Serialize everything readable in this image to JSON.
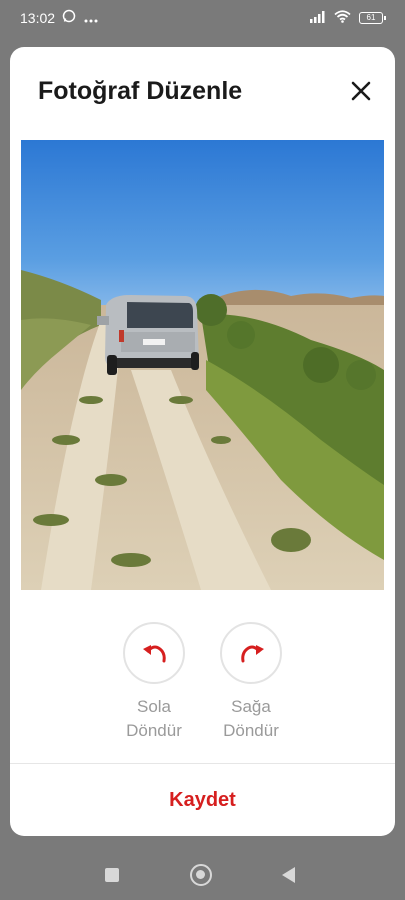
{
  "status_bar": {
    "time": "13:02",
    "battery": "61",
    "icons": [
      "whatsapp-icon",
      "more-dots-icon",
      "signal-icon",
      "wifi-icon",
      "battery-icon"
    ]
  },
  "modal": {
    "title": "Fotoğraf Düzenle",
    "close_icon": "close-icon",
    "photo_subject": "dirt-road-with-van-landscape",
    "rotate_left": {
      "label": "Sola\nDöndür",
      "icon": "rotate-left-icon"
    },
    "rotate_right": {
      "label": "Sağa\nDöndür",
      "icon": "rotate-right-icon"
    },
    "save_label": "Kaydet"
  },
  "nav_bar": {
    "icons": [
      "recents-square-icon",
      "home-circle-icon",
      "back-triangle-icon"
    ]
  },
  "colors": {
    "accent": "#d61f1f",
    "overlay": "#7a7a7a",
    "label_gray": "#9a9a9a"
  }
}
